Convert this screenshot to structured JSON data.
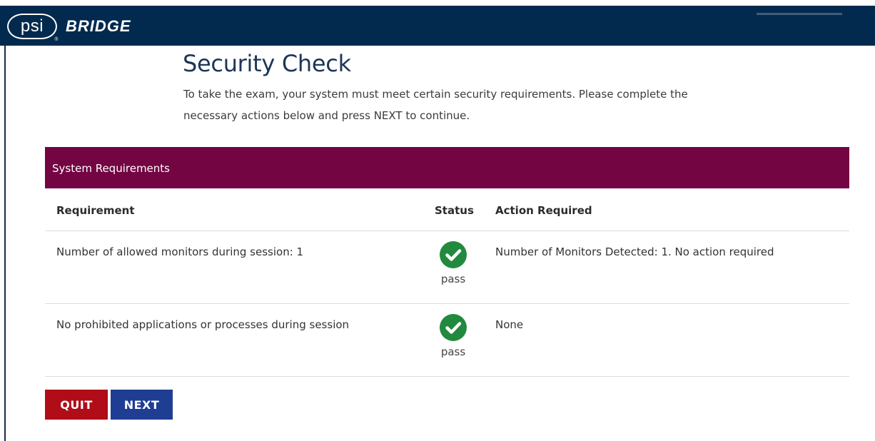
{
  "brand": {
    "logo_text": "psi",
    "logo_reg": "®",
    "product": "BRIDGE"
  },
  "page": {
    "title": "Security Check",
    "intro_line1": "To take the exam, your system must meet certain security requirements. Please complete the",
    "intro_line2": "necessary actions below and press NEXT to continue."
  },
  "panel": {
    "header": "System Requirements"
  },
  "table": {
    "columns": {
      "requirement": "Requirement",
      "status": "Status",
      "action": "Action Required"
    },
    "rows": [
      {
        "requirement": "Number of allowed monitors during session: 1",
        "status": "pass",
        "status_icon": "check-circle-icon",
        "action": "Number of Monitors Detected: 1. No action required"
      },
      {
        "requirement": "No prohibited applications or processes during session",
        "status": "pass",
        "status_icon": "check-circle-icon",
        "action": "None"
      }
    ]
  },
  "buttons": {
    "quit": "QUIT",
    "next": "NEXT"
  },
  "colors": {
    "topbar": "#012a4e",
    "panel_header": "#730543",
    "pass_green": "#218a3f",
    "quit_red": "#b00d18",
    "next_blue": "#1e3d93"
  }
}
